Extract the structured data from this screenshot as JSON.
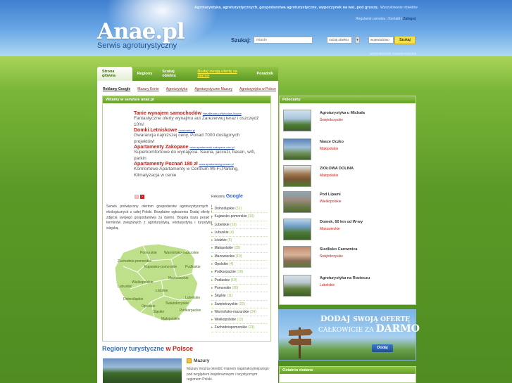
{
  "header": {
    "logo_text": "Anae.pl",
    "logo_subtitle": "Serwis agroturystyczny",
    "tagline": "Agroturystyka, agroturystycznych, gospodarstwa agroturystyczne, wypoczynek na wsi, pod gruszą",
    "top_right_link": "Wyszukiwanie obiektów",
    "login_links": "Regulamin serwisu | Kontakt |",
    "login_label": "Zaloguj"
  },
  "search": {
    "label": "Szukaj:",
    "placeholder": "miasto",
    "select1": "rodzaj obiektu",
    "select2": "województwo",
    "button": "Szukaj",
    "advanced_link": "wyszukiwanie zaawansowane"
  },
  "nav": {
    "items": [
      "Strona główna",
      "Regiony",
      "Szukaj obiektu",
      "Dodaj swoją ofertę za darmo",
      "Poradnik"
    ]
  },
  "ads_bar": {
    "items": [
      "Reklamy Google",
      "Mazury Konie",
      "Agroturystyka",
      "Agroturystyczne Mazury",
      "Agroturystyka w Polsce"
    ]
  },
  "welcome": {
    "title": "Witamy w serwisie anae.pl",
    "ads": [
      {
        "title": "Tanie wynajem samochodów",
        "url": "HeraBeauto.pl/Wroclaw-Nocne",
        "desc": "Fantastyczne oferty wynajmu aut Zarezerwuj teraz i oszczędź 10%!"
      },
      {
        "title": "Domki Letniskowe",
        "url": "domkostka.pl",
        "desc": "Gwarancja najniższej ceny. Ponad 7000 dostępnych projektów!"
      },
      {
        "title": "Apartamenty Zakopane",
        "url": "www.apartamenty-zakopane.com.pl",
        "desc": "Superkomfortowe do wynajęcia. Sauna, jaccuzi, basen, wifi, parkin"
      },
      {
        "title": "Apartamenty Poznań 180 zł",
        "url": "www.apartamentypoznan.pl",
        "desc": "Komfortowe Apartamenty w Centrum Wi-Fi,Parking, Klimatyzacja w cenie"
      }
    ],
    "google_label": "Reklamy",
    "google_brand": "Google",
    "intro": "Serwis poświęcony ofertom gospodarstw agroturystycznych i ekologicznych z całej Polski. Bezpłatne ogłoszenia Dodaj ofertę i zdjęcia swojego gospodarstwa za darmo. Bogata baza porad i terminów związanych z agroturystyką, ekoturystyką i turystyką wiejską."
  },
  "map_labels": [
    "Pomorskie",
    "Warmińsko-mazurskie",
    "Zachodnio-pomorskie",
    "Kujawsko-pomorskie",
    "Podlaskie",
    "Wielkopolskie",
    "Mazowieckie",
    "Lubuskie",
    "Łódzkie",
    "Dolnośląskie",
    "Opolskie",
    "Świętokrzyskie",
    "Lubelskie",
    "Śląskie",
    "Małopolskie",
    "Podkarpackie"
  ],
  "regions": [
    {
      "name": "Dolnośląskie",
      "count": "(31)"
    },
    {
      "name": "Kujawsko-pomorskie",
      "count": "(10)"
    },
    {
      "name": "Lubelskie",
      "count": "(19)"
    },
    {
      "name": "Lubuskie",
      "count": "(4)"
    },
    {
      "name": "Łódzkie",
      "count": "(6)"
    },
    {
      "name": "Małopolskie",
      "count": "(35)"
    },
    {
      "name": "Mazowieckie",
      "count": "(10)"
    },
    {
      "name": "Opolskie",
      "count": "(4)"
    },
    {
      "name": "Podkarpackie",
      "count": "(19)"
    },
    {
      "name": "Podlaskie",
      "count": "(19)"
    },
    {
      "name": "Pomorskie",
      "count": "(30)"
    },
    {
      "name": "Śląskie",
      "count": "(11)"
    },
    {
      "name": "Świętokrzyskie",
      "count": "(22)"
    },
    {
      "name": "Warmińsko-mazurskie",
      "count": "(24)"
    },
    {
      "name": "Wielkopolskie",
      "count": "(12)"
    },
    {
      "name": "Zachodniopomorskie",
      "count": "(23)"
    }
  ],
  "regions_section": {
    "title_main": "Regiony turystyczne",
    "title_suffix": "w Polsce",
    "featured_name": "Mazury",
    "featured_desc": "Mazury można określić mianem najatrakcyjniejszego pod względem krajobrazowym i turystycznym regionem Polski."
  },
  "recommended": {
    "title": "Polecamy",
    "items": [
      {
        "name": "Agroturystyka u Michała",
        "region": "Świętokrzyskie"
      },
      {
        "name": "Nasze Oczko",
        "region": "Małopolskie"
      },
      {
        "name": "ZIOŁOWA DOLINA",
        "region": "Małopolskie"
      },
      {
        "name": "Pod Lipami",
        "region": "Wielkopolskie"
      },
      {
        "name": "Domek, 60 km od W-wy",
        "region": "Mazowieckie"
      },
      {
        "name": "Siedlisko Carownica",
        "region": "Świętokrzyskie"
      },
      {
        "name": "Agroturystyka na Roztoczu",
        "region": "Lubelskie"
      }
    ]
  },
  "banner": {
    "line1_a": "DODAJ",
    "line1_b": "SWOJĄ OFERTĘ",
    "line2_a": "CAŁKOWICIE ZA",
    "line2_b": "DARMO",
    "button": "Dodaj"
  },
  "recent": {
    "title": "Ostatnio dodane"
  }
}
